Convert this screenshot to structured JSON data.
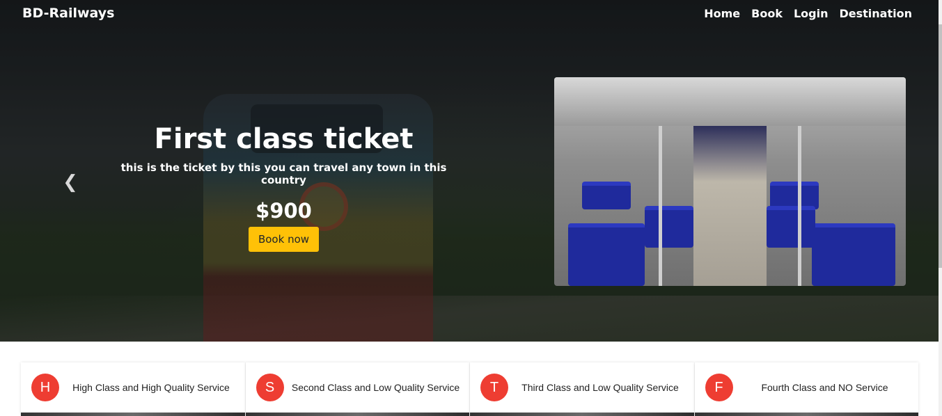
{
  "navbar": {
    "brand": "BD-Railways",
    "links": [
      "Home",
      "Book",
      "Login",
      "Destination"
    ]
  },
  "carousel": {
    "title": "First class ticket",
    "description": "this is the ticket by this you can travel any town in this country",
    "price": "$900",
    "button_label": "Book now",
    "prev_icon": "chevron-left-icon",
    "next_icon": "chevron-right-icon",
    "image": "train-interior-photo"
  },
  "services": [
    {
      "letter": "H",
      "label": "High Class and High Quality Service"
    },
    {
      "letter": "S",
      "label": "Second Class and Low Quality Service"
    },
    {
      "letter": "T",
      "label": "Third Class and Low Quality Service"
    },
    {
      "letter": "F",
      "label": "Fourth Class and NO Service"
    }
  ],
  "colors": {
    "accent_button": "#ffc107",
    "service_badge": "#ee3d32",
    "nav_text": "#ffffff"
  }
}
